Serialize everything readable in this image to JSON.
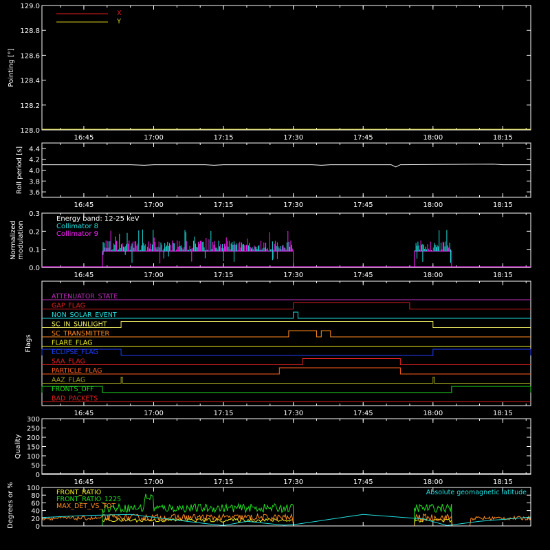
{
  "time_ticks": [
    "16:45",
    "17:00",
    "17:15",
    "17:30",
    "17:45",
    "18:00",
    "18:15"
  ],
  "time_range": [
    "16:36",
    "18:21"
  ],
  "panels": {
    "pointing": {
      "ylabel": "Pointing [°]",
      "yticks": [
        "128.0",
        "128.2",
        "128.4",
        "128.6",
        "128.8",
        "129.0"
      ],
      "ylim": [
        128.0,
        129.0
      ],
      "legend": [
        {
          "label": "X",
          "color": "#dd2020"
        },
        {
          "label": "Y",
          "color": "#d8d020"
        }
      ],
      "baseline_value": 128.0
    },
    "roll": {
      "ylabel": "Roll period [s]",
      "yticks": [
        "3.6",
        "3.8",
        "4.0",
        "4.2",
        "4.4"
      ],
      "ylim": [
        3.5,
        4.5
      ],
      "color": "#ffffff",
      "series": [
        [
          "16:36",
          4.1
        ],
        [
          "16:55",
          4.1
        ],
        [
          "16:58",
          4.09
        ],
        [
          "17:00",
          4.1
        ],
        [
          "17:11",
          4.1
        ],
        [
          "17:13",
          4.09
        ],
        [
          "17:15",
          4.1
        ],
        [
          "17:34",
          4.1
        ],
        [
          "17:36",
          4.09
        ],
        [
          "17:38",
          4.1
        ],
        [
          "17:51",
          4.1
        ],
        [
          "17:52",
          4.06
        ],
        [
          "17:53",
          4.1
        ],
        [
          "18:13",
          4.11
        ],
        [
          "18:15",
          4.1
        ],
        [
          "18:21",
          4.1
        ]
      ]
    },
    "modulation": {
      "ylabel_lines": [
        "Normalized",
        "modulation"
      ],
      "yticks": [
        "0.0",
        "0.1",
        "0.2",
        "0.3"
      ],
      "ylim": [
        0.0,
        0.3
      ],
      "legend": [
        {
          "label": "Energy band: 12-25 keV",
          "color": "#ffffff"
        },
        {
          "label": "Collimator 8",
          "color": "#20e0e0"
        },
        {
          "label": "Collimator 9",
          "color": "#ff20ff"
        }
      ],
      "active_intervals": [
        [
          "16:49",
          "17:30"
        ],
        [
          "17:56",
          "18:04"
        ]
      ],
      "base_level": 0.09
    },
    "flags": {
      "ylabel": "Flags",
      "items": [
        {
          "label": "ATTENUATOR_STATE",
          "color": "#c030c0",
          "on": []
        },
        {
          "label": "GAP_FLAG",
          "color": "#dd2020",
          "on": [
            [
              "17:30",
              "17:55"
            ]
          ]
        },
        {
          "label": "NON_SOLAR_EVENT",
          "color": "#20e0e0",
          "on": [
            [
              "17:30",
              "17:31"
            ]
          ]
        },
        {
          "label": "SC_IN_SUNLIGHT",
          "color": "#f0f060",
          "on": [
            [
              "16:53",
              "18:00"
            ]
          ]
        },
        {
          "label": "SC_TRANSMITTER",
          "color": "#ff8c20",
          "on": [
            [
              "17:29",
              "17:35"
            ],
            [
              "17:36",
              "17:38"
            ]
          ]
        },
        {
          "label": "FLARE_FLAG",
          "color": "#f0f020",
          "on": []
        },
        {
          "label": "ECLIPSE_FLAG",
          "color": "#2040ff",
          "on": [
            [
              "16:36",
              "16:53"
            ],
            [
              "18:00",
              "18:21"
            ]
          ]
        },
        {
          "label": "SAA_FLAG",
          "color": "#dd2020",
          "on": [
            [
              "17:32",
              "17:53"
            ]
          ]
        },
        {
          "label": "PARTICLE_FLAG",
          "color": "#ff6020",
          "on": [
            [
              "17:27",
              "17:53"
            ]
          ]
        },
        {
          "label": "AAZ_FLAG",
          "color": "#a0a020",
          "on": [
            [
              "16:53",
              "16:53"
            ],
            [
              "18:00",
              "18:00"
            ]
          ]
        },
        {
          "label": "FRONTS_OFF",
          "color": "#20e020",
          "on": [
            [
              "16:36",
              "16:49"
            ],
            [
              "18:04",
              "18:21"
            ]
          ]
        },
        {
          "label": "BAD_PACKETS",
          "color": "#dd2020",
          "on": []
        }
      ]
    },
    "quality": {
      "ylabel": "Quality",
      "yticks": [
        "0",
        "50",
        "100",
        "150",
        "200",
        "250",
        "300"
      ],
      "ylim": [
        0,
        300
      ],
      "series_value": 0
    },
    "ratio": {
      "ylabel": "Degrees or %",
      "yticks": [
        "0",
        "20",
        "40",
        "60",
        "80",
        "100"
      ],
      "ylim": [
        0,
        100
      ],
      "legend_left": [
        {
          "label": "FRONT_RATIO",
          "color": "#f0f020"
        },
        {
          "label": "FRONT_RATIO_1225",
          "color": "#20e020"
        },
        {
          "label": "MAX_DET_VS_TOT",
          "color": "#ff8c20"
        }
      ],
      "legend_right": {
        "label": "Absolute geomagnetic latitude",
        "color": "#20e0e0"
      },
      "active_intervals": [
        [
          "16:49",
          "17:30"
        ],
        [
          "17:56",
          "18:04"
        ]
      ],
      "geomag_points": [
        [
          "16:36",
          22
        ],
        [
          "16:45",
          27
        ],
        [
          "16:55",
          30
        ],
        [
          "17:03",
          18
        ],
        [
          "17:12",
          5
        ],
        [
          "17:15",
          1
        ],
        [
          "17:20",
          12
        ],
        [
          "17:28",
          2
        ],
        [
          "17:31",
          5
        ],
        [
          "17:45",
          30
        ],
        [
          "17:58",
          18
        ],
        [
          "18:03",
          1
        ],
        [
          "18:10",
          12
        ],
        [
          "18:21",
          23
        ]
      ],
      "orange_level": 20,
      "green_level": 42,
      "yellow_level": 15
    }
  }
}
